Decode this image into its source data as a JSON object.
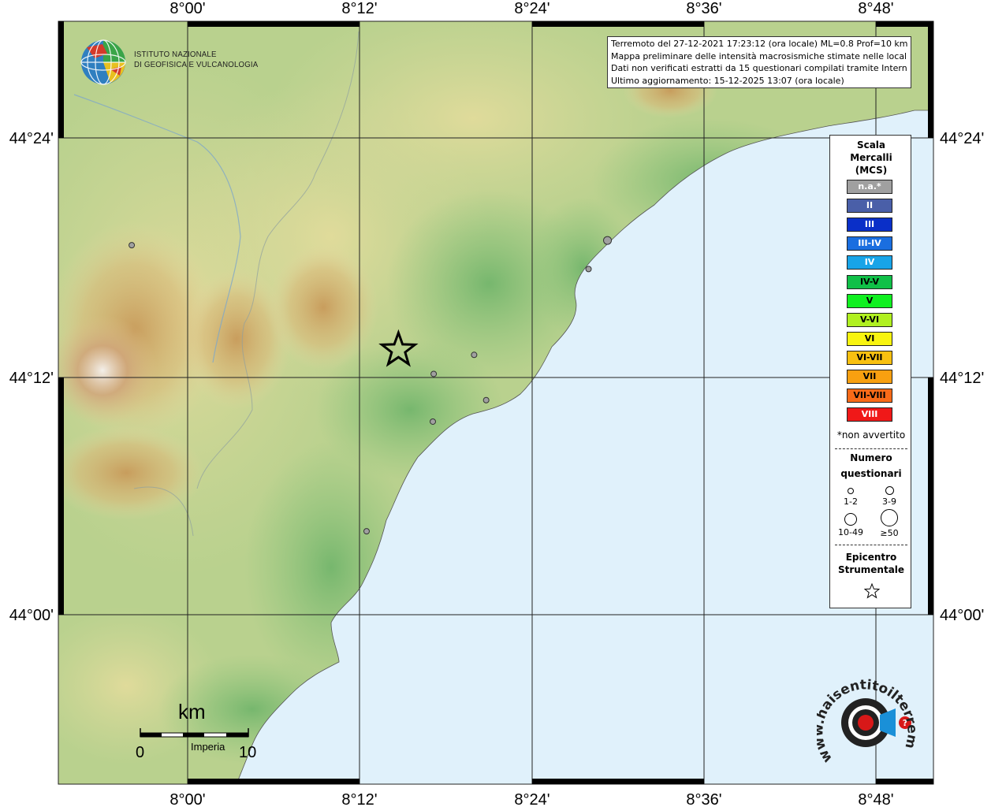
{
  "map": {
    "lon_labels_top": [
      "8°00'",
      "8°12'",
      "8°24'",
      "8°36'",
      "8°48'"
    ],
    "lon_labels_bottom": [
      "8°00'",
      "8°12'",
      "8°24'",
      "8°36'",
      "8°48'"
    ],
    "lat_labels_left": [
      "44°24'",
      "44°12'",
      "44°00'"
    ],
    "lat_labels_right": [
      "44°24'",
      "44°12'",
      "44°00'"
    ],
    "sea_color": "#e0f1fb",
    "grid_color": "#222222"
  },
  "info": {
    "line1": "Terremoto del 27-12-2021 17:23:12 (ora locale) ML=0.8 Prof=10 km",
    "line2": "Mappa preliminare delle intensità macrosismiche stimate nelle località",
    "line3": "Dati non verificati estratti da 15 questionari compilati tramite Internet.",
    "line4": "Ultimo aggiornamento: 15-12-2025 13:07 (ora locale)"
  },
  "logo": {
    "ingv_line1": "ISTITUTO NAZIONALE",
    "ingv_line2": "DI GEOFISICA E VULCANOLOGIA",
    "hsit_text": "www.haisentitoilterremoto.it"
  },
  "legend": {
    "title_1": "Scala",
    "title_2": "Mercalli",
    "title_3": "(MCS)",
    "scale": [
      {
        "label": "n.a.*",
        "color": "#a0a0a0",
        "text": "#ffffff"
      },
      {
        "label": "II",
        "color": "#4a5fa8",
        "text": "#ffffff"
      },
      {
        "label": "III",
        "color": "#0a2fc8",
        "text": "#ffffff"
      },
      {
        "label": "III-IV",
        "color": "#1a6ee0",
        "text": "#ffffff"
      },
      {
        "label": "IV",
        "color": "#18a4e8",
        "text": "#ffffff"
      },
      {
        "label": "IV-V",
        "color": "#10c048",
        "text": "#000000"
      },
      {
        "label": "V",
        "color": "#10f020",
        "text": "#000000"
      },
      {
        "label": "V-VI",
        "color": "#b0f020",
        "text": "#000000"
      },
      {
        "label": "VI",
        "color": "#f8f410",
        "text": "#000000"
      },
      {
        "label": "VI-VII",
        "color": "#f8c010",
        "text": "#000000"
      },
      {
        "label": "VII",
        "color": "#f8a010",
        "text": "#000000"
      },
      {
        "label": "VII-VIII",
        "color": "#f86a18",
        "text": "#000000"
      },
      {
        "label": "VIII",
        "color": "#f01818",
        "text": "#ffffff"
      }
    ],
    "note": "*non avvertito",
    "numero_1": "Numero",
    "numero_2": "questionari",
    "sizes": [
      "1-2",
      "3-9",
      "10-49",
      "≥50"
    ],
    "epi_1": "Epicentro",
    "epi_2": "Strumentale"
  },
  "scalebar": {
    "unit": "km",
    "start": "0",
    "end": "10"
  },
  "city": "Imperia",
  "epicenter": {
    "lon": 8.245,
    "lat": 44.222,
    "icon": "star-icon"
  },
  "observations": [
    {
      "lon": 7.935,
      "lat": 44.31,
      "count_class": "1-2"
    },
    {
      "lon": 8.466,
      "lat": 44.29,
      "count_class": "1-2"
    },
    {
      "lon": 8.488,
      "lat": 44.314,
      "count_class": "3-9"
    },
    {
      "lon": 8.333,
      "lat": 44.218,
      "count_class": "1-2"
    },
    {
      "lon": 8.286,
      "lat": 44.202,
      "count_class": "1-2"
    },
    {
      "lon": 8.347,
      "lat": 44.18,
      "count_class": "1-2"
    },
    {
      "lon": 8.285,
      "lat": 44.162,
      "count_class": "1-2"
    },
    {
      "lon": 8.208,
      "lat": 44.07,
      "count_class": "1-2"
    }
  ]
}
